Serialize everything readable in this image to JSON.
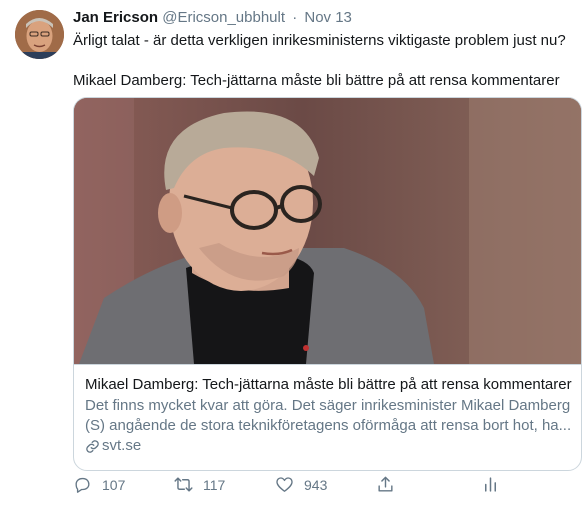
{
  "author": {
    "name": "Jan Ericson",
    "handle": "@Ericson_ubbhult",
    "separator": "·",
    "date": "Nov 13"
  },
  "tweet": {
    "line1": "Ärligt talat - är detta verkligen inrikesministerns viktigaste problem just nu?",
    "line2": "Mikael Damberg: Tech-jättarna måste bli bättre på att rensa kommentarer"
  },
  "card": {
    "title": "Mikael Damberg: Tech-jättarna måste bli bättre på att rensa kommentarer",
    "description_line1": "Det finns mycket kvar att göra. Det säger inrikesminister Mikael Damberg",
    "description_line2": "(S) angående de stora teknikföretagens oförmåga att rensa bort hot, ha...",
    "domain": "svt.se",
    "link_icon": "link-icon"
  },
  "actions": {
    "reply": {
      "icon": "reply-icon",
      "count": "107"
    },
    "retweet": {
      "icon": "retweet-icon",
      "count": "117"
    },
    "like": {
      "icon": "heart-icon",
      "count": "943"
    },
    "share": {
      "icon": "share-icon"
    },
    "analytics": {
      "icon": "analytics-icon"
    }
  },
  "colors": {
    "text_primary": "#14171a",
    "text_secondary": "#657786",
    "border": "#ccd6dd"
  }
}
